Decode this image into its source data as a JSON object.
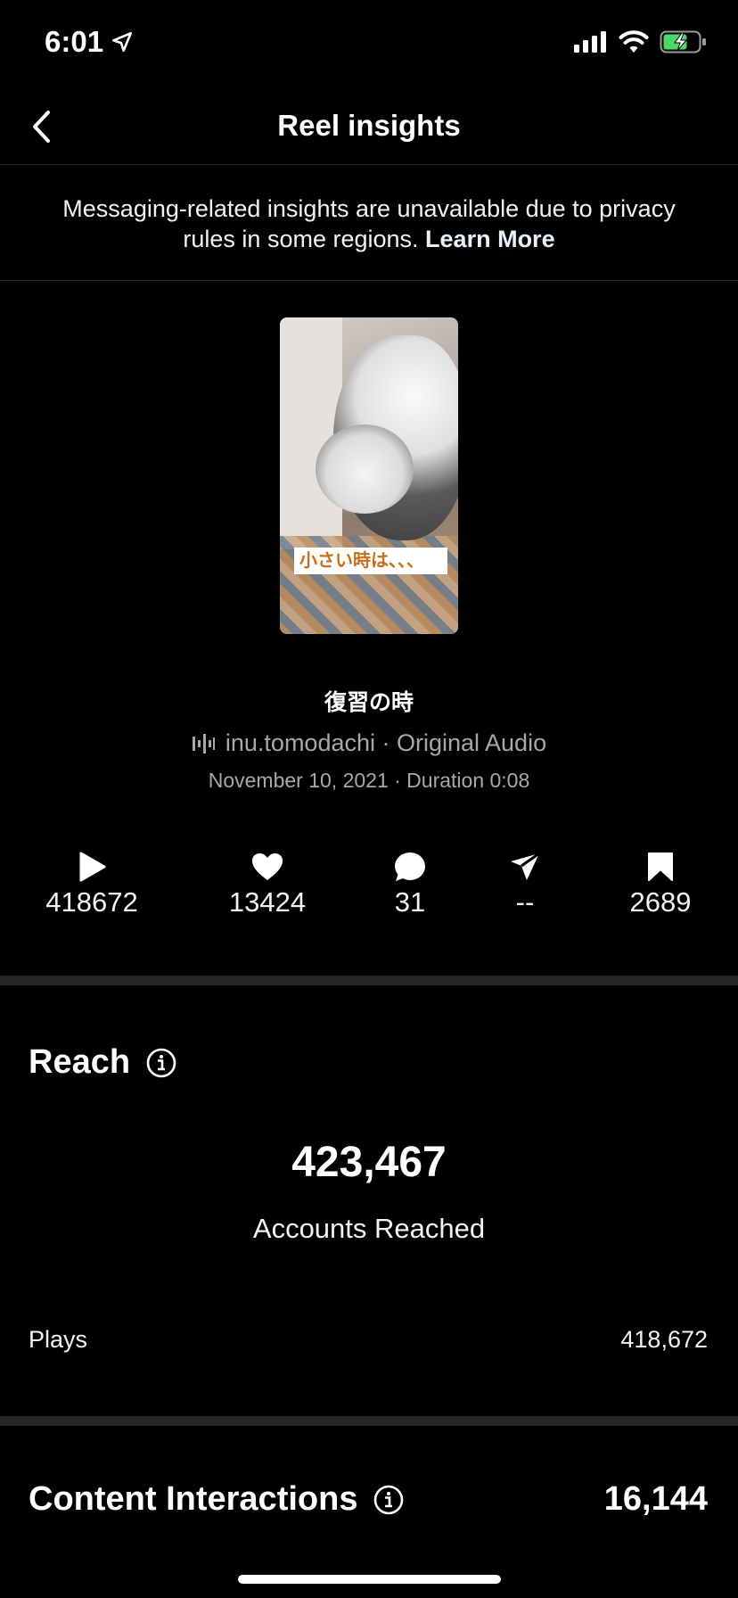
{
  "status_bar": {
    "time": "6:01"
  },
  "nav": {
    "title": "Reel insights"
  },
  "notice": {
    "text": "Messaging-related insights are unavailable due to privacy rules in some regions.",
    "link": "Learn More"
  },
  "reel": {
    "thumbnail_caption": "小さい時は、、、",
    "title": "復習の時",
    "audio": "inu.tomodachi · Original Audio",
    "meta": "November 10, 2021 · Duration 0:08"
  },
  "metrics": {
    "plays": "418672",
    "likes": "13424",
    "comments": "31",
    "shares": "--",
    "saves": "2689"
  },
  "reach": {
    "title": "Reach",
    "accounts_reached_value": "423,467",
    "accounts_reached_label": "Accounts Reached",
    "plays_label": "Plays",
    "plays_value": "418,672"
  },
  "content_interactions": {
    "title": "Content Interactions",
    "value": "16,144"
  }
}
